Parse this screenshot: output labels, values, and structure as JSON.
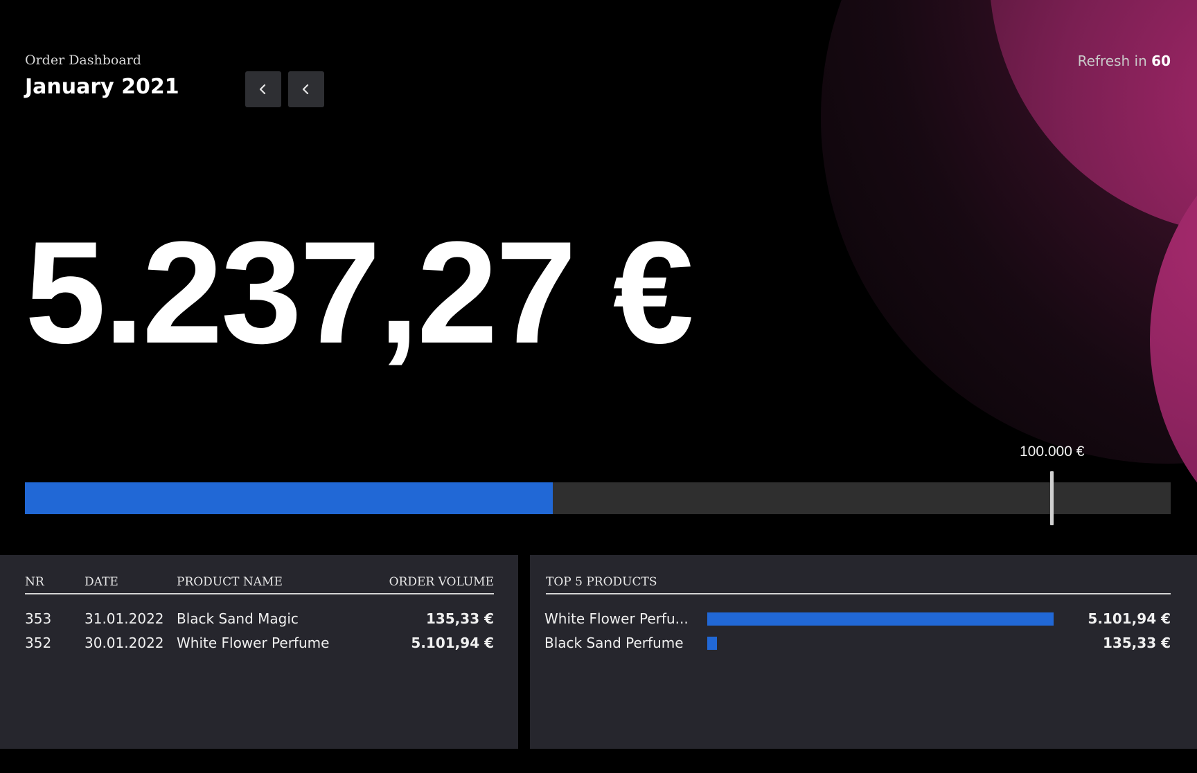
{
  "header": {
    "subtitle": "Order Dashboard",
    "period": "January 2021",
    "refresh_prefix": "Refresh in",
    "refresh_seconds": "60"
  },
  "icons": {
    "prev": "chevron-left-icon",
    "next": "chevron-left-icon"
  },
  "summary": {
    "total": "5.237,27 €",
    "goal_label": "100.000 €",
    "progress_fraction": 0.461
  },
  "orders": {
    "columns": [
      "NR",
      "DATE",
      "PRODUCT NAME",
      "ORDER VOLUME"
    ],
    "rows": [
      {
        "nr": "353",
        "date": "31.01.2022",
        "product": "Black Sand Magic",
        "volume": "135,33 €"
      },
      {
        "nr": "352",
        "date": "30.01.2022",
        "product": "White Flower Perfume",
        "volume": "5.101,94 €"
      }
    ]
  },
  "top_products": {
    "title": "TOP 5 PRODUCTS",
    "items": [
      {
        "name": "White Flower Perfu...",
        "value": 5101.94,
        "label": "5.101,94 €"
      },
      {
        "name": "Black Sand Perfume",
        "value": 135.33,
        "label": "135,33 €"
      }
    ]
  },
  "colors": {
    "accent": "#2168d6",
    "panel": "#26262d",
    "track": "#2f2f2f",
    "glow": "#a5276a"
  }
}
